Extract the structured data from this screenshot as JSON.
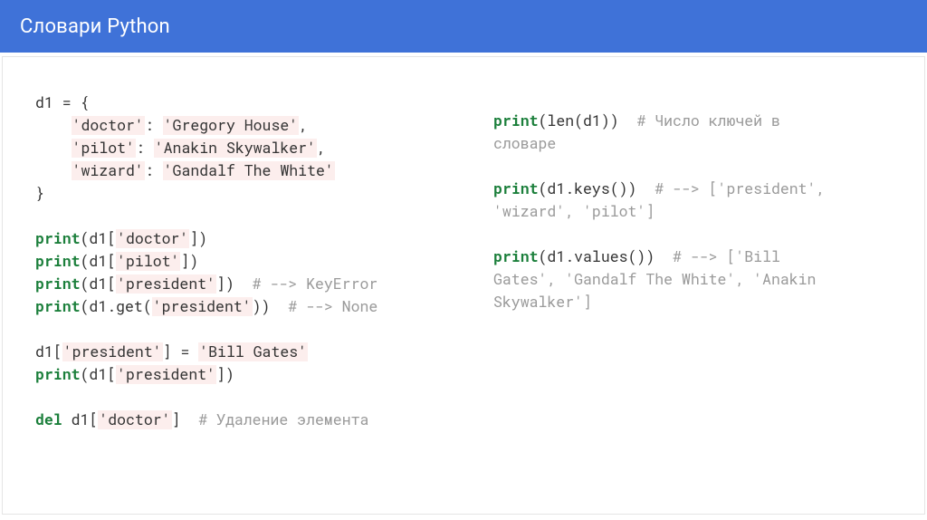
{
  "header": {
    "title": "Словари Python"
  },
  "left": {
    "l1": "d1 = {",
    "l2_indent": "    ",
    "l2_str": "'doctor'",
    "l2_mid": ": ",
    "l2_str2": "'Gregory House'",
    "l2_end": ",",
    "l3_indent": "    ",
    "l3_str": "'pilot'",
    "l3_mid": ": ",
    "l3_str2": "'Anakin Skywalker'",
    "l3_end": ",",
    "l4_indent": "    ",
    "l4_str": "'wizard'",
    "l4_mid": ": ",
    "l4_str2": "'Gandalf The White'",
    "l5": "}",
    "print": "print",
    "del": "del",
    "p1_a": "(d1[",
    "p1_s": "'doctor'",
    "p1_b": "])",
    "p2_a": "(d1[",
    "p2_s": "'pilot'",
    "p2_b": "])",
    "p3_a": "(d1[",
    "p3_s": "'president'",
    "p3_b": "])  ",
    "p3_c": "# --> KeyError",
    "p4_a": "(d1.get(",
    "p4_s": "'president'",
    "p4_b": "))  ",
    "p4_c": "# --> None",
    "as_a": "d1[",
    "as_s": "'president'",
    "as_b": "] = ",
    "as_s2": "'Bill Gates'",
    "p5_a": "(d1[",
    "p5_s": "'president'",
    "p5_b": "])",
    "dl_a": " d1[",
    "dl_s": "'doctor'",
    "dl_b": "]  ",
    "dl_c": "# Удаление элемента"
  },
  "right": {
    "print": "print",
    "r1_a": "(len(d1))  ",
    "r1_c1": "# Число ключей в",
    "r1_c2": "словаре",
    "r2_a": "(d1.keys())  ",
    "r2_c1": "# --> ['president',",
    "r2_c2": "'wizard', 'pilot']",
    "r3_a": "(d1.values())  ",
    "r3_c1": "# --> ['Bill",
    "r3_c2": "Gates', 'Gandalf The White', 'Anakin",
    "r3_c3": "Skywalker']"
  }
}
